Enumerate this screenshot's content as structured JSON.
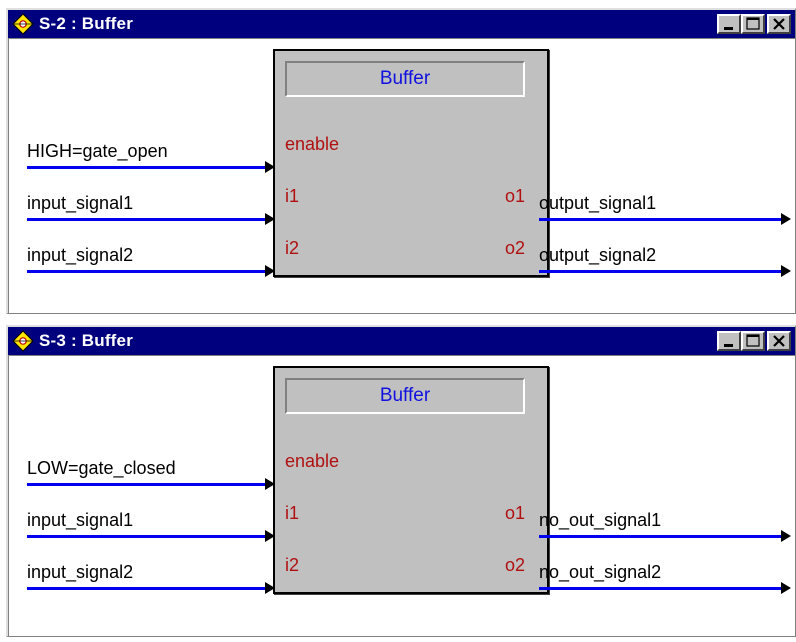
{
  "windows": [
    {
      "title": "S-2 : Buffer",
      "block": {
        "name": "Buffer",
        "ports": {
          "enable": "enable",
          "i1": "i1",
          "i2": "i2",
          "o1": "o1",
          "o2": "o2"
        }
      },
      "inputs": [
        "HIGH=gate_open",
        "input_signal1",
        "input_signal2"
      ],
      "outputs": [
        "output_signal1",
        "output_signal2"
      ]
    },
    {
      "title": "S-3 : Buffer",
      "block": {
        "name": "Buffer",
        "ports": {
          "enable": "enable",
          "i1": "i1",
          "i2": "i2",
          "o1": "o1",
          "o2": "o2"
        }
      },
      "inputs": [
        "LOW=gate_closed",
        "input_signal1",
        "input_signal2"
      ],
      "outputs": [
        "no_out_signal1",
        "no_out_signal2"
      ]
    }
  ],
  "colors": {
    "titlebar": "#00007e",
    "wire": "#0000ee",
    "port_label": "#b01010",
    "block_title": "#1010e0"
  },
  "icons": [
    "app-diamond-icon",
    "minimize-icon",
    "maximize-icon",
    "close-icon",
    "arrow-icon"
  ]
}
